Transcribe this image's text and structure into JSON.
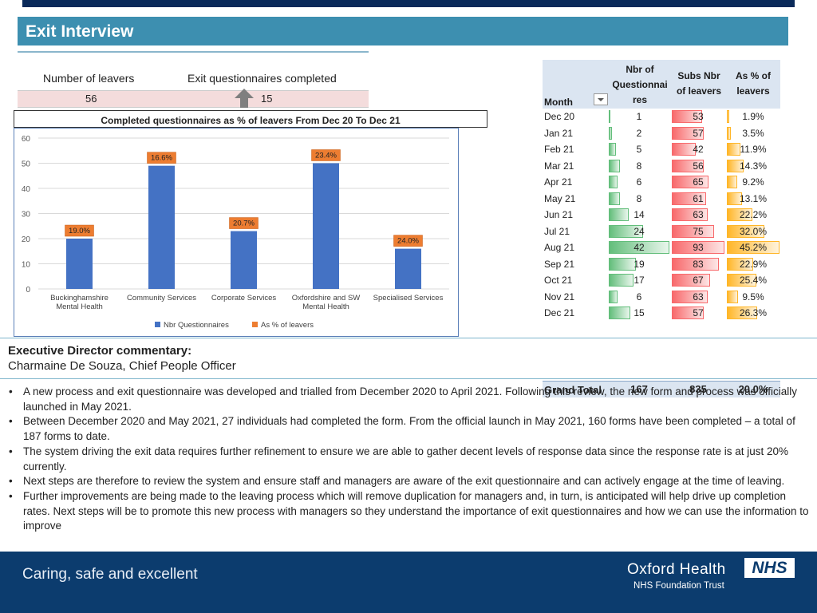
{
  "title": "Exit Interview",
  "kpis": {
    "leavers_label": "Number of leavers",
    "leavers_value": "56",
    "questionnaires_label": "Exit questionnaires completed",
    "questionnaires_value": "15",
    "trend_icon": "up-arrow-icon"
  },
  "chart_caption": "Completed questionnaires as % of leavers From Dec 20 To Dec 21",
  "chart_data": {
    "type": "bar",
    "categories": [
      "Buckinghamshire Mental Health",
      "Community Services",
      "Corporate Services",
      "Oxfordshire and SW Mental Health",
      "Specialised Services"
    ],
    "category_lines": [
      [
        "Buckinghamshire",
        "Mental Health"
      ],
      [
        "Community Services"
      ],
      [
        "Corporate Services"
      ],
      [
        "Oxfordshire and SW",
        "Mental Health"
      ],
      [
        "Specialised Services"
      ]
    ],
    "series": [
      {
        "name": "Nbr Questionnaires",
        "values": [
          20,
          49,
          23,
          50,
          16
        ]
      },
      {
        "name": "As % of leavers",
        "labels": [
          "19.0%",
          "16.6%",
          "20.7%",
          "23.4%",
          "24.0%"
        ]
      }
    ],
    "ylim": [
      0,
      60
    ],
    "yticks": [
      0,
      10,
      20,
      30,
      40,
      50,
      60
    ],
    "grid": true,
    "legend_position": "bottom",
    "colors": {
      "bar": "#4472c4",
      "label_bg": "#ed7d31"
    }
  },
  "table": {
    "headers": {
      "month": "Month",
      "nbr_q": [
        "Nbr of",
        "Questionnai",
        "res"
      ],
      "subs": [
        "Subs Nbr",
        "of leavers"
      ],
      "pct": [
        "As % of",
        "leavers"
      ]
    },
    "rows": [
      {
        "month": "Dec 20",
        "q": 1,
        "l": 53,
        "pct": "1.9%",
        "pv": 1.9
      },
      {
        "month": "Jan 21",
        "q": 2,
        "l": 57,
        "pct": "3.5%",
        "pv": 3.5
      },
      {
        "month": "Feb 21",
        "q": 5,
        "l": 42,
        "pct": "11.9%",
        "pv": 11.9
      },
      {
        "month": "Mar 21",
        "q": 8,
        "l": 56,
        "pct": "14.3%",
        "pv": 14.3
      },
      {
        "month": "Apr 21",
        "q": 6,
        "l": 65,
        "pct": "9.2%",
        "pv": 9.2
      },
      {
        "month": "May 21",
        "q": 8,
        "l": 61,
        "pct": "13.1%",
        "pv": 13.1
      },
      {
        "month": "Jun 21",
        "q": 14,
        "l": 63,
        "pct": "22.2%",
        "pv": 22.2
      },
      {
        "month": "Jul 21",
        "q": 24,
        "l": 75,
        "pct": "32.0%",
        "pv": 32.0
      },
      {
        "month": "Aug 21",
        "q": 42,
        "l": 93,
        "pct": "45.2%",
        "pv": 45.2
      },
      {
        "month": "Sep 21",
        "q": 19,
        "l": 83,
        "pct": "22.9%",
        "pv": 22.9
      },
      {
        "month": "Oct 21",
        "q": 17,
        "l": 67,
        "pct": "25.4%",
        "pv": 25.4
      },
      {
        "month": "Nov 21",
        "q": 6,
        "l": 63,
        "pct": "9.5%",
        "pv": 9.5
      },
      {
        "month": "Dec 21",
        "q": 15,
        "l": 57,
        "pct": "26.3%",
        "pv": 26.3
      }
    ],
    "grand_total": {
      "label": "Grand Total",
      "q": "167",
      "l": "835",
      "pct": "20.0%"
    }
  },
  "commentary": {
    "title": "Executive Director commentary:",
    "author": "Charmaine De Souza, Chief People Officer",
    "bullets": [
      "A new process and exit questionnaire was developed and trialled from December 2020 to April 2021.  Following this review, the new form and process was officially launched in May 2021.",
      "Between December 2020 and May 2021, 27 individuals had completed the form.  From the official launch in May 2021, 160 forms have been completed – a total of 187 forms to date.",
      "The system driving the exit data requires further refinement to ensure we are able to gather decent levels of response data since the response rate is at just 20% currently.",
      "Next steps are therefore to review the system and ensure staff and managers are aware of the exit questionnaire and can actively engage at the time of leaving.",
      "Further improvements are being made to the leaving process which will remove duplication for managers and, in turn, is anticipated will help drive up completion rates.  Next steps will be to promote this new process with managers so they understand the importance of exit questionnaires and how we can use the information to improve"
    ]
  },
  "footer": {
    "tagline": "Caring, safe and excellent",
    "org": "Oxford Health",
    "trust": "NHS Foundation Trust",
    "logo_text": "NHS"
  }
}
